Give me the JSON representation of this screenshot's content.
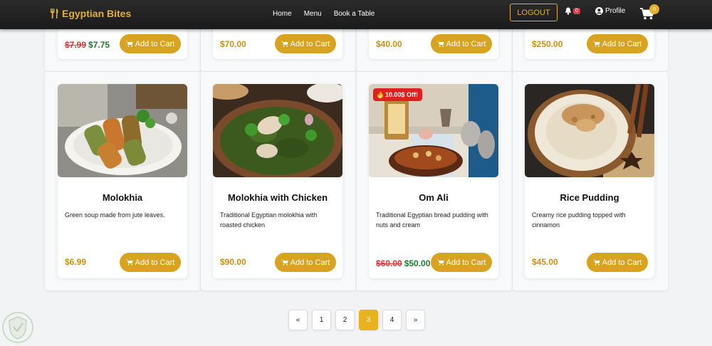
{
  "nav": {
    "brand": "Egyptian Bites",
    "links": [
      "Home",
      "Menu",
      "Book a Table"
    ],
    "logout": "LOGOUT",
    "notifications_count": "0",
    "profile": "Profile",
    "cart_count": "0"
  },
  "top_row": [
    {
      "old_price": "$7.99",
      "price": "$7.75",
      "button": "Add to Cart"
    },
    {
      "price": "$70.00",
      "button": "Add to Cart"
    },
    {
      "price": "$40.00",
      "button": "Add to Cart"
    },
    {
      "price": "$250.00",
      "button": "Add to Cart"
    }
  ],
  "products": [
    {
      "title": "Molokhia",
      "description": "Green soup made from jute leaves.",
      "price": "$6.99",
      "button": "Add to Cart"
    },
    {
      "title": "Molokhia with Chicken",
      "description": "Traditional Egyptian molokhia with roasted chicken",
      "price": "$90.00",
      "button": "Add to Cart"
    },
    {
      "title": "Om Ali",
      "description": "Traditional Egyptian bread pudding with nuts and cream",
      "old_price": "$60.00",
      "price": "$50.00",
      "badge": "10.00$ Off!",
      "button": "Add to Cart"
    },
    {
      "title": "Rice Pudding",
      "description": "Creamy rice pudding topped with cinnamon",
      "price": "$45.00",
      "button": "Add to Cart"
    }
  ],
  "pagination": {
    "prev": "«",
    "pages": [
      "1",
      "2",
      "3",
      "4"
    ],
    "active": "3",
    "next": "»"
  },
  "colors": {
    "accent": "#e4b12c",
    "button": "#d9a322",
    "sale": "#d33333",
    "discount": "#1e7a2e"
  }
}
